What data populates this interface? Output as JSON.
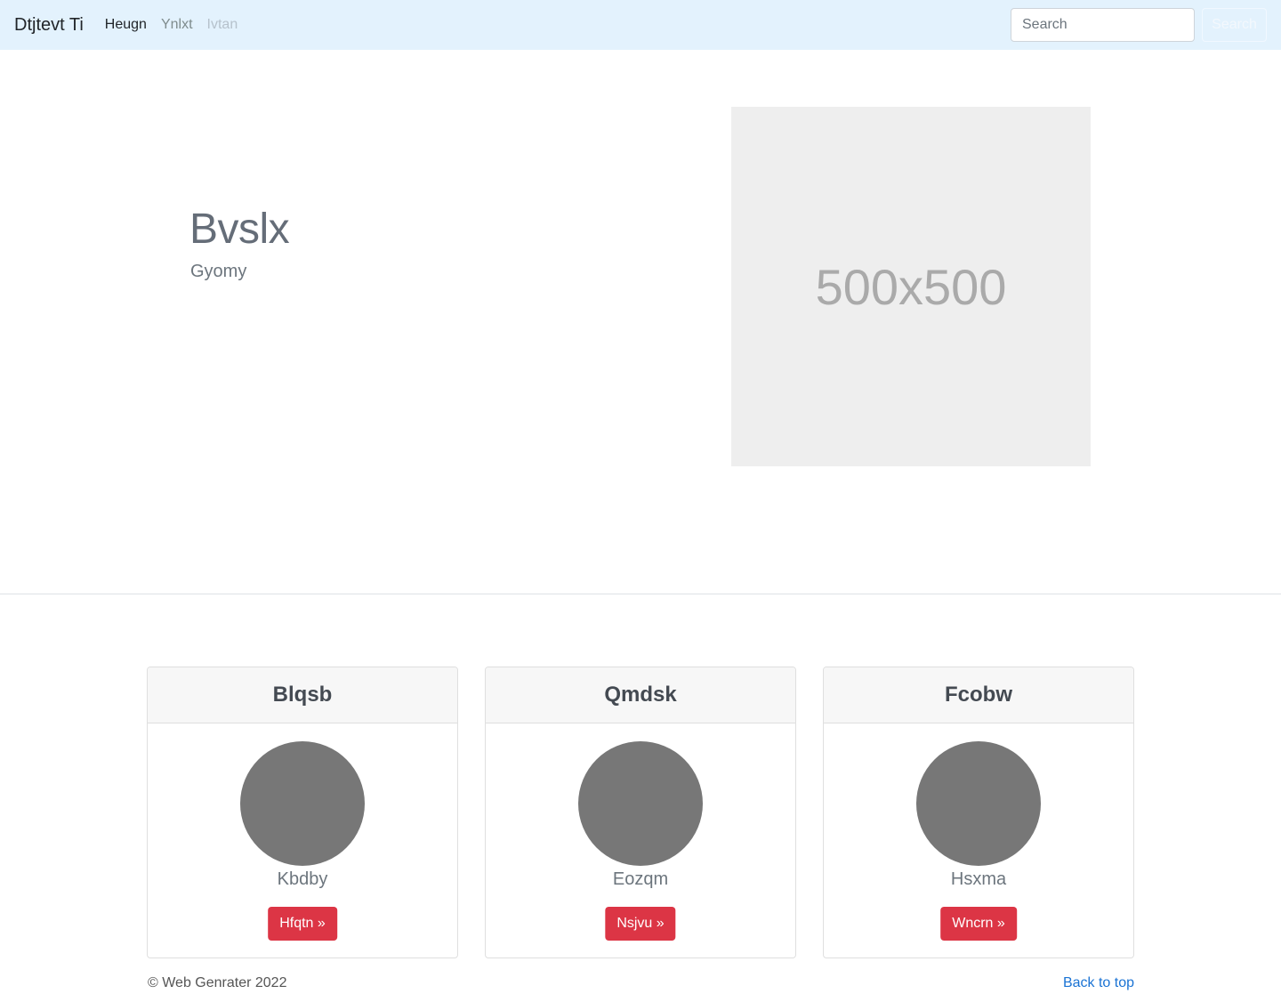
{
  "navbar": {
    "brand": "Dtjtevt Ti",
    "links": [
      {
        "label": "Heugn",
        "state": "active"
      },
      {
        "label": "Ynlxt",
        "state": "normal"
      },
      {
        "label": "Ivtan",
        "state": "disabled"
      }
    ],
    "search_placeholder": "Search",
    "search_button": "Search",
    "background": "#e3f2fd"
  },
  "hero": {
    "title": "Bvslx",
    "subtitle": "Gyomy",
    "image_label": "500x500"
  },
  "cards": [
    {
      "header": "Blqsb",
      "label": "Kbdby",
      "button": "Hfqtn »"
    },
    {
      "header": "Qmdsk",
      "label": "Eozqm",
      "button": "Nsjvu »"
    },
    {
      "header": "Fcobw",
      "label": "Hsxma",
      "button": "Wncrn »"
    }
  ],
  "footer": {
    "copyright": "© Web Genrater 2022",
    "back_to_top": "Back to top"
  },
  "colors": {
    "accent_button": "#dc3545",
    "link": "#1a73d4",
    "avatar": "#777777"
  }
}
